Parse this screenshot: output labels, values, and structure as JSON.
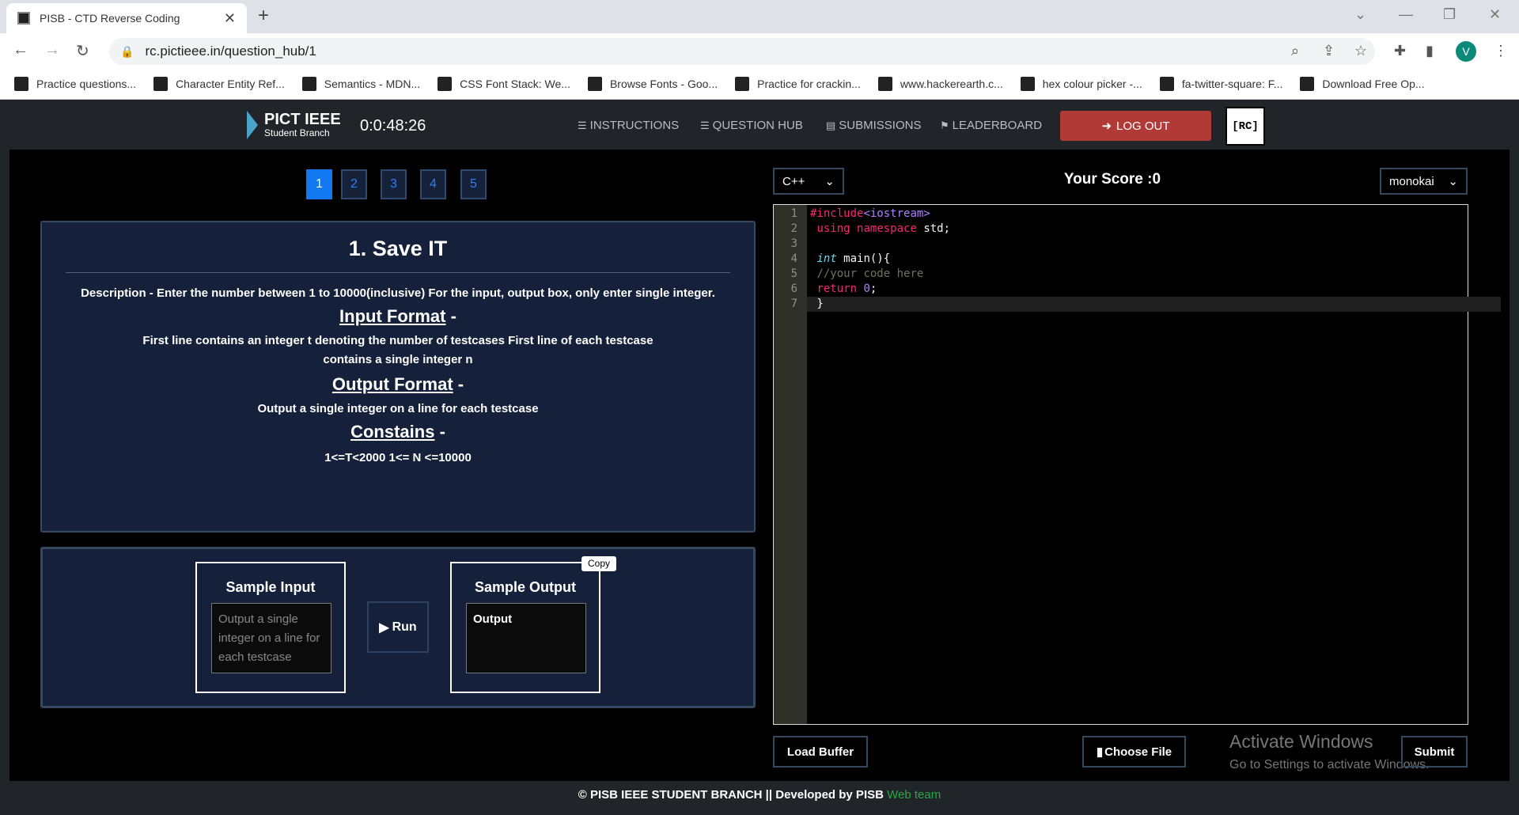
{
  "browser": {
    "tab_title": "PISB - CTD Reverse Coding",
    "url": "rc.pictieee.in/question_hub/1",
    "avatar": "V",
    "bookmarks": [
      "Practice questions...",
      "Character Entity Ref...",
      "Semantics - MDN...",
      "CSS Font Stack: We...",
      "Browse Fonts - Goo...",
      "Practice for crackin...",
      "www.hackerearth.c...",
      "hex colour picker -...",
      "fa-twitter-square: F...",
      "Download Free Op..."
    ]
  },
  "nav": {
    "logo_title": "PICT IEEE",
    "logo_sub": "Student Branch",
    "timer": "0:0:48:26",
    "items": [
      {
        "label": "INSTRUCTIONS",
        "icon": "list-icon"
      },
      {
        "label": "QUESTION HUB",
        "icon": "list-icon"
      },
      {
        "label": "SUBMISSIONS",
        "icon": "file-icon"
      },
      {
        "label": "LEADERBOARD",
        "icon": "flag-icon"
      }
    ],
    "logout": "LOG OUT",
    "rc_logo": "RC"
  },
  "questions": {
    "numbers": [
      "1",
      "2",
      "3",
      "4",
      "5"
    ],
    "active": "1"
  },
  "question": {
    "title": "1. Save IT",
    "description": "Description - Enter the number between 1 to 10000(inclusive) For the input, output box, only enter single integer.",
    "input_format_label": "Input Format",
    "input_format": "First line contains an integer t denoting the number of testcases First line of each testcase contains a single integer n",
    "output_format_label": "Output Format",
    "output_format": "Output a single integer on a line for each testcase",
    "constraints_label": "Constains",
    "constraints": "1<=T<2000 1<= N <=10000",
    "dash": "-"
  },
  "sample": {
    "input_title": "Sample Input",
    "input_placeholder": "Output a single integer on a line for each testcase",
    "run": "Run",
    "output_title": "Sample Output",
    "output_value": "Output",
    "copy": "Copy"
  },
  "editor": {
    "language": "C++",
    "score": "Your Score :0",
    "theme": "monokai",
    "lines": [
      "#include<iostream>",
      " using namespace std;",
      "",
      " int main(){",
      " //your code here",
      " return 0;",
      " }"
    ]
  },
  "actions": {
    "load_buffer": "Load Buffer",
    "choose_file": "Choose File",
    "submit": "Submit"
  },
  "watermark": {
    "title": "Activate Windows",
    "subtitle": "Go to Settings to activate Windows."
  },
  "footer": {
    "text": "© PISB IEEE STUDENT BRANCH || Developed by PISB ",
    "link": "Web team"
  },
  "colors": {
    "logout": "#b13a36",
    "active_question": "#1278f2",
    "panel": "#15213a",
    "link": "#28a745"
  }
}
